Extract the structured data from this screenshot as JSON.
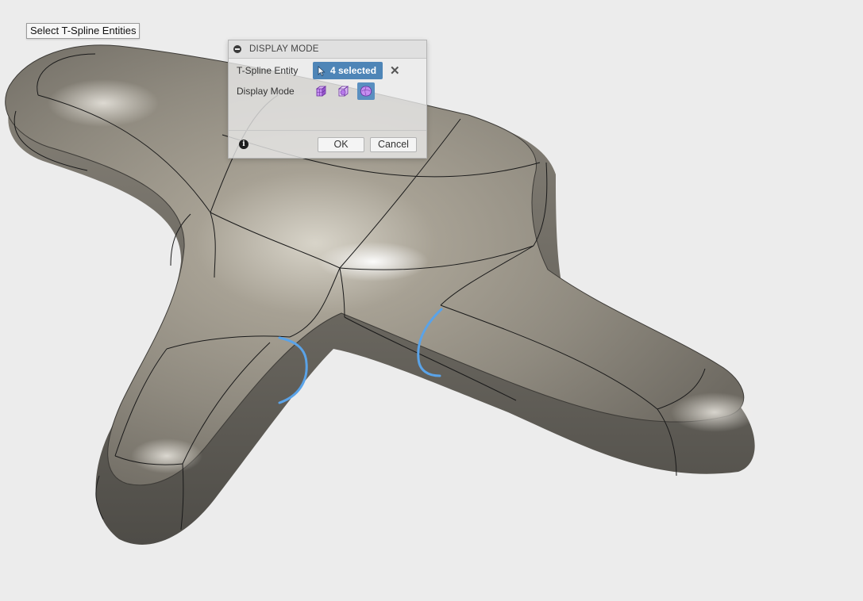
{
  "tooltip": {
    "text": "Select T-Spline Entities"
  },
  "dialog": {
    "title": "DISPLAY MODE",
    "entity_label": "T-Spline Entity",
    "entity_value": "4 selected",
    "mode_label": "Display Mode",
    "modes": [
      {
        "icon": "box-display-icon",
        "active": false
      },
      {
        "icon": "control-frame-display-icon",
        "active": false
      },
      {
        "icon": "smooth-display-icon",
        "active": true
      }
    ],
    "ok_label": "OK",
    "cancel_label": "Cancel"
  },
  "colors": {
    "background": "#ececec",
    "surface_mid": "#9d978a",
    "surface_dark": "#5f5d56",
    "edge_line": "#1a1a1a",
    "selected_edge": "#5aa3e8",
    "selection_accent": "#4e85b7"
  }
}
